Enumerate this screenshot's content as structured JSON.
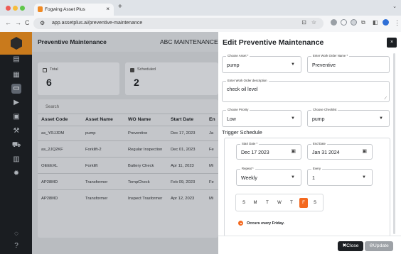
{
  "browser": {
    "tab_title": "Fogwing Asset Plus",
    "new_tab": "+",
    "url": "app.assetplus.ai/preventive-maintenance",
    "traffic_lights": [
      "#ee5b55",
      "#f6bd3b",
      "#5fc74a"
    ]
  },
  "sidebar": {
    "icons": [
      "dashboard-icon",
      "assets-icon",
      "maintenance-icon",
      "play-icon",
      "chat-icon",
      "wrench-icon",
      "car-icon",
      "bar-chart-icon",
      "settings-icon",
      "help-chat-icon",
      "help-icon"
    ]
  },
  "main": {
    "title": "Preventive Maintenance",
    "org": "ABC MAINTENANCE",
    "cards": [
      {
        "label": "Total",
        "value": "6"
      },
      {
        "label": "Scheduled",
        "value": "2"
      }
    ],
    "search_placeholder": "Search",
    "columns": [
      "Asset Code",
      "Asset Name",
      "WO Name",
      "Start Date",
      "En"
    ],
    "rows": [
      [
        "as_YRJJDM",
        "pump",
        "Preventive",
        "Dec 17, 2023",
        "Ja"
      ],
      [
        "as_2JQ2KF",
        "Forklift-2",
        "Regular Inspection",
        "Dec 01, 2023",
        "Fe"
      ],
      [
        "OEEEXL",
        "Forklift",
        "Battery Check",
        "Apr 11, 2023",
        "Mi"
      ],
      [
        "AP28MD",
        "Transformer",
        "TempCheck",
        "Feb 09, 2023",
        "Fe"
      ],
      [
        "AP28MD",
        "Transformer",
        "Inspect Trasformer",
        "Apr 12, 2023",
        "Mi"
      ]
    ]
  },
  "panel": {
    "title": "Edit Preventive Maintenance",
    "close_icon": "×",
    "asset_label": "Choose Asset *",
    "asset_value": "pump",
    "wo_name_label": "Enter Work Order Name *",
    "wo_name_value": "Preventive",
    "desc_label": "Enter Work Order description",
    "desc_value": "check oil level",
    "priority_label": "Choose Priority",
    "priority_value": "Low",
    "checklist_label": "Choose Checklist",
    "checklist_value": "pump",
    "trigger_title": "Trigger Schedule",
    "start_label": "Start Date *",
    "start_value": "Dec 17 2023",
    "end_label": "End Date",
    "end_value": "Jan 31 2024",
    "repeat_label": "Repeat *",
    "repeat_value": "Weekly",
    "every_label": "Every",
    "every_value": "1",
    "days": [
      "S",
      "M",
      "T",
      "W",
      "T",
      "F",
      "S"
    ],
    "selected_day": "F",
    "occurs_text": "Occurs every Friday.",
    "close_button": "✖Close",
    "update_button": "⊘Update",
    "accent": "#f4691f"
  }
}
